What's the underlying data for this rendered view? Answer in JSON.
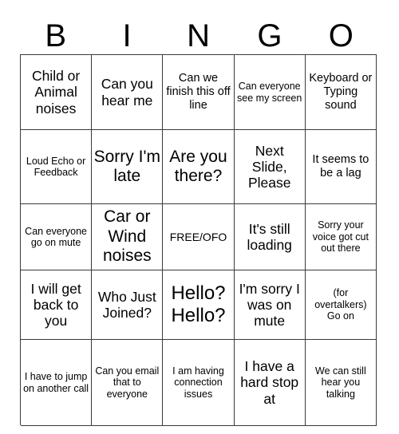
{
  "card": {
    "title": "BINGO",
    "header_letters": [
      "B",
      "I",
      "N",
      "G",
      "O"
    ],
    "grid_size": "5x5",
    "border_color": "#3a3a3a",
    "background_color": "#ffffff",
    "text_color": "#000000",
    "free_space_label": "FREE/OFO",
    "cells": [
      [
        {
          "text": "Child or Animal noises",
          "size": "md"
        },
        {
          "text": "Can you hear me",
          "size": "md"
        },
        {
          "text": "Can we finish this off line",
          "size": "sm"
        },
        {
          "text": "Can everyone see my screen",
          "size": "xs"
        },
        {
          "text": "Keyboard or Typing sound",
          "size": "sm"
        }
      ],
      [
        {
          "text": "Loud Echo or Feedback",
          "size": "xs"
        },
        {
          "text": "Sorry I'm late",
          "size": "lg"
        },
        {
          "text": "Are you there?",
          "size": "lg"
        },
        {
          "text": "Next Slide, Please",
          "size": "md"
        },
        {
          "text": "It seems to be a lag",
          "size": "sm"
        }
      ],
      [
        {
          "text": "Can everyone go on mute",
          "size": "xs"
        },
        {
          "text": "Car or Wind noises",
          "size": "lg"
        },
        {
          "text": "FREE/OFO",
          "size": "free"
        },
        {
          "text": "It's still loading",
          "size": "md"
        },
        {
          "text": "Sorry your voice got cut out there",
          "size": "xs"
        }
      ],
      [
        {
          "text": "I will get back to you",
          "size": "md"
        },
        {
          "text": "Who Just Joined?",
          "size": "md"
        },
        {
          "text": "Hello? Hello?",
          "size": "xl"
        },
        {
          "text": "I'm sorry I was on mute",
          "size": "md"
        },
        {
          "text": "(for overtalkers) Go on",
          "size": "xs"
        }
      ],
      [
        {
          "text": "I have to jump on another call",
          "size": "xs"
        },
        {
          "text": "Can you email that to everyone",
          "size": "xs"
        },
        {
          "text": "I am having connection issues",
          "size": "xs"
        },
        {
          "text": "I have a hard stop at",
          "size": "md"
        },
        {
          "text": "We can still hear you talking",
          "size": "xs"
        }
      ]
    ]
  }
}
